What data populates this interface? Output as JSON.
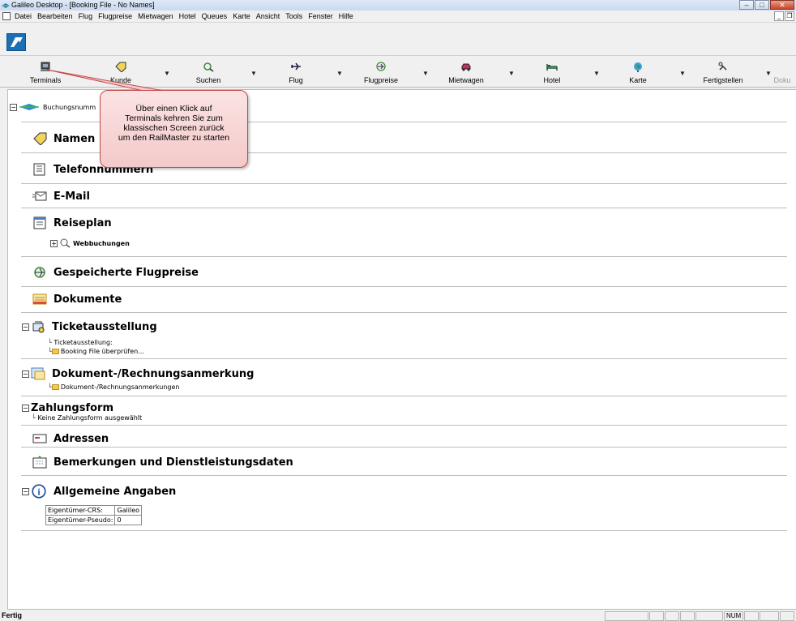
{
  "window": {
    "title": "Galileo Desktop - [Booking File - No Names]"
  },
  "menu": [
    "Datei",
    "Bearbeiten",
    "Flug",
    "Flugpreise",
    "Mietwagen",
    "Hotel",
    "Queues",
    "Karte",
    "Ansicht",
    "Tools",
    "Fenster",
    "Hilfe"
  ],
  "toolbar": {
    "terminals": "Terminals",
    "kunde": "Kunde",
    "suchen": "Suchen",
    "flug": "Flug",
    "flugpreise": "Flugpreise",
    "mietwagen": "Mietwagen",
    "hotel": "Hotel",
    "karte": "Karte",
    "fertigstellen": "Fertigstellen",
    "doku": "Doku"
  },
  "booking": {
    "root_label": "Buchungsnumm",
    "namen": "Namen",
    "telefonnummern": "Telefonnummern",
    "email": "E-Mail",
    "reiseplan": "Reiseplan",
    "webbuchungen": "Webbuchungen",
    "gespeicherte_flugpreise": "Gespeicherte Flugpreise",
    "dokumente": "Dokumente",
    "ticketausstellung": "Ticketausstellung",
    "ticketausstellung_sub1": "Ticketausstellung:",
    "ticketausstellung_sub2": "Booking File überprüfen...",
    "dokument_rechnung": "Dokument-/Rechnungsanmerkung",
    "dokument_rechnung_sub": "Dokument-/Rechnungsanmerkungen",
    "zahlungsform": "Zahlungsform",
    "zahlungsform_sub": "Keine Zahlungsform ausgewählt",
    "adressen": "Adressen",
    "bemerkungen": "Bemerkungen und Dienstleistungsdaten",
    "allgemeine_angaben": "Allgemeine Angaben",
    "info": [
      {
        "key": "Eigentümer-CRS:",
        "value": "Galileo"
      },
      {
        "key": "Eigentümer-Pseudo:",
        "value": "0"
      }
    ]
  },
  "callout": {
    "line1": "Über einen Klick auf",
    "line2": "Terminals kehren Sie zum",
    "line3": "klassischen Screen zurück",
    "line4": "um den RailMaster zu starten"
  },
  "status": {
    "text": "Fertig",
    "num": "NUM"
  },
  "colors": {
    "callout_fill": "#f4c9c9",
    "callout_border": "#c24848",
    "arrow": "#c24848"
  }
}
